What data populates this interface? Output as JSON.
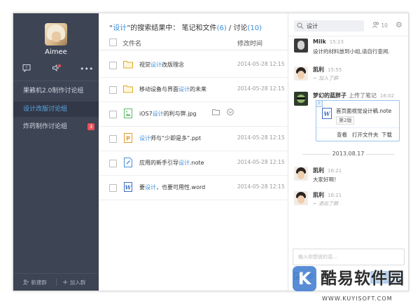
{
  "sidebar": {
    "user_name": "Aimee",
    "groups": [
      {
        "label": "果籁机2.0制作讨论组",
        "active": false,
        "badge": ""
      },
      {
        "label": "设计改版讨论组",
        "active": true,
        "badge": ""
      },
      {
        "label": "炸药制作讨论组",
        "active": false,
        "badge": "3"
      }
    ],
    "new_group_label": "新建群",
    "join_group_label": "加入群",
    "icons": [
      "message-icon",
      "speaker-icon",
      "more-icon"
    ]
  },
  "middle": {
    "title_prefix": "“",
    "query": "设计",
    "title_mid": "”的搜索结果中：",
    "files_label": "笔记和文件",
    "files_count": "(6)",
    "sep": " / ",
    "discuss_label": "讨论",
    "discuss_count": "(10)",
    "col_name": "文件名",
    "col_time": "修改时间",
    "files": [
      {
        "pre": "视觉",
        "hl": "设计",
        "post": "改版理念",
        "date": "2014-05-28",
        "time": "12:15",
        "icon": "folder"
      },
      {
        "pre": "移动设备与界面",
        "hl": "设计",
        "post": "的未来",
        "date": "2014-05-28",
        "time": "12:15",
        "icon": "folder"
      },
      {
        "pre": "iOS7",
        "hl": "设计",
        "post": "的利与弊.jpg",
        "date": "2014-05-28",
        "time": "12:15",
        "icon": "image"
      },
      {
        "pre": "",
        "hl": "设计",
        "post": "师与“少即是多”.ppt",
        "date": "2014-05-28",
        "time": "12:15",
        "icon": "ppt"
      },
      {
        "pre": "应用的新手引导",
        "hl": "设计",
        "post": ".note",
        "date": "2014-05-28",
        "time": "12:15",
        "icon": "note"
      },
      {
        "pre": "要",
        "hl": "设计",
        "post": "，也要可用性.word",
        "date": "2014-05-28",
        "time": "12:15",
        "icon": "word"
      }
    ]
  },
  "right": {
    "search_value": "设计",
    "member_count": "10",
    "messages": {
      "m1_name": "Milk",
      "m1_time": "15:23",
      "m1_text": "设计的材料放到小组,请自行查阅.",
      "m2_name": "凯利",
      "m2_time": "15:55",
      "m2_sys": "加入了群",
      "m3_name": "梦幻的蓝胖子",
      "m3_action": "上传了笔记",
      "m3_time": "16:02",
      "m4_name": "凯利",
      "m4_time": "16:21",
      "m4_text": "大家好啊！",
      "m5_name": "凯利",
      "m5_time": "16:21",
      "m5_sys": "退出了群"
    },
    "file_card": {
      "name": "首页面视觉设计稿.note",
      "version": "第2版",
      "actions": [
        "查看",
        "打开文件夹",
        "下载"
      ]
    },
    "date_separator": "2013.08.17",
    "composer_placeholder": "输入你想说的话..."
  },
  "watermark": {
    "brand": "酷易软件园",
    "url": "WWW.KUYISOFT.COM"
  },
  "colors": {
    "sidebar_bg": "#3d4454",
    "accent": "#3b8bd8",
    "badge": "#e8505b"
  }
}
